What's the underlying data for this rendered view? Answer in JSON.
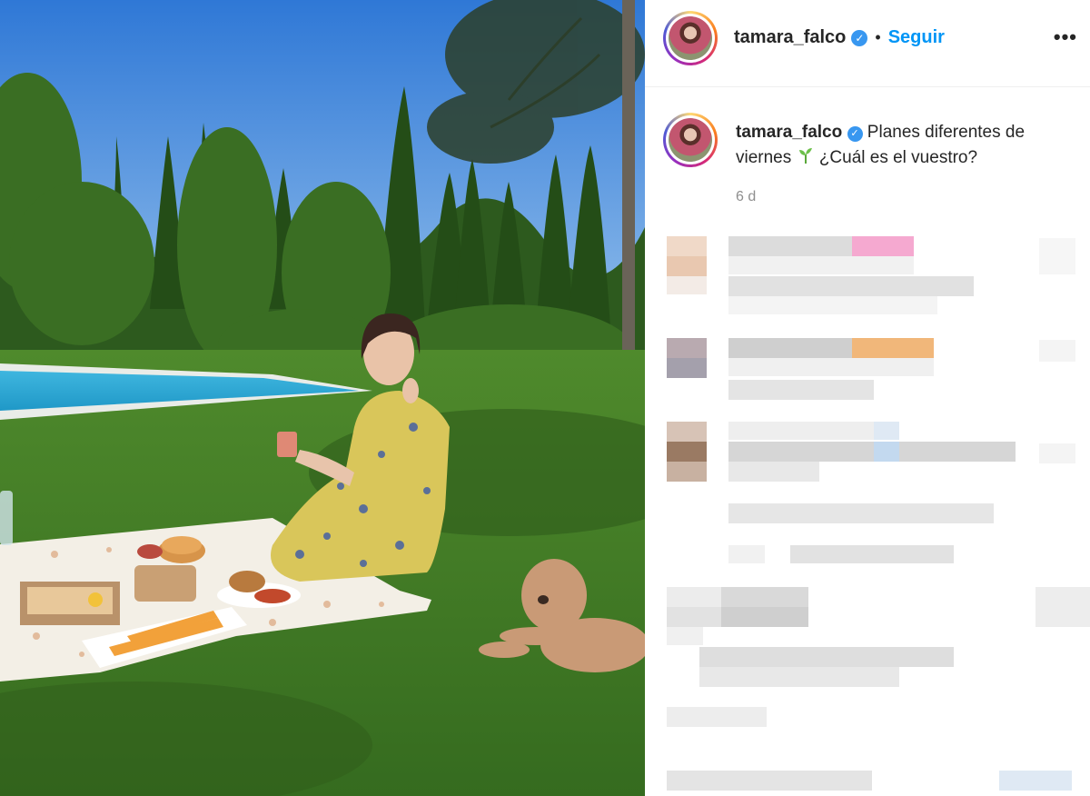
{
  "post": {
    "username": "tamara_falco",
    "follow_label": "Seguir",
    "separator": "•",
    "more_label": "•••",
    "caption_text_1": "Planes diferentes de viernes",
    "caption_text_2": "¿Cuál es el vuestro?",
    "age": "6 d"
  },
  "colors": {
    "accent": "#0095f6",
    "verified": "#3897f0",
    "text": "#262626",
    "muted": "#8e8e8e"
  },
  "icons": {
    "verified": "verified-badge-icon",
    "more": "more-options-icon",
    "sprout": "seedling-emoji-icon"
  }
}
